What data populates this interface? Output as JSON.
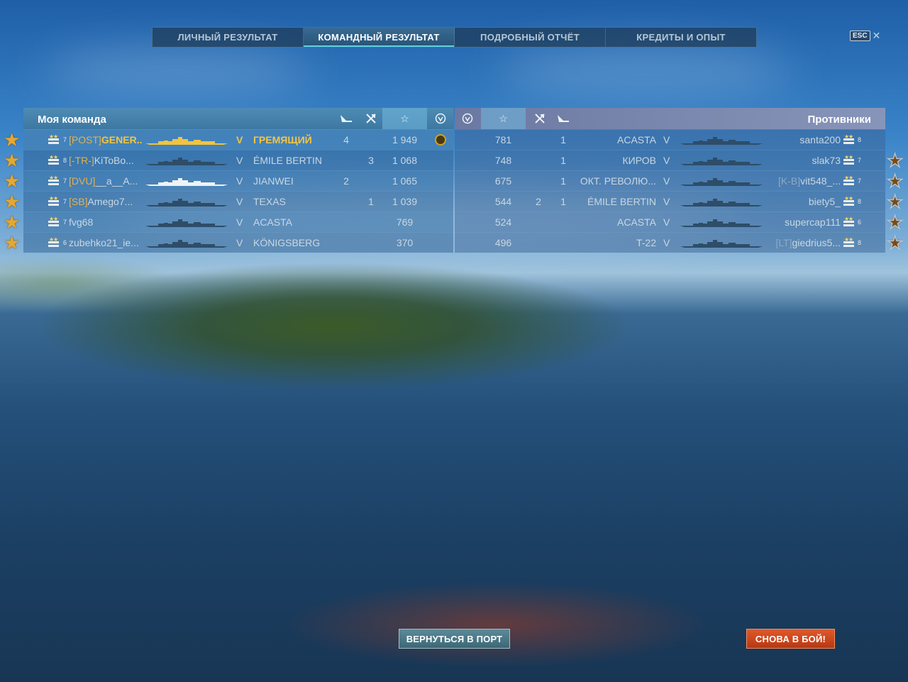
{
  "tabs": [
    {
      "label": "ЛИЧНЫЙ РЕЗУЛЬТАТ",
      "active": false
    },
    {
      "label": "КОМАНДНЫЙ РЕЗУЛЬТАТ",
      "active": true
    },
    {
      "label": "ПОДРОБНЫЙ ОТЧЁТ",
      "active": false
    },
    {
      "label": "КРЕДИТЫ И ОПЫТ",
      "active": false
    }
  ],
  "esc_label": "ESC",
  "my_team": {
    "title": "Моя команда",
    "rows": [
      {
        "tier": "7",
        "clan": "[POST]",
        "name": "GENER...",
        "ship_tier": "V",
        "ship": "ГРЕМЯЩИЙ",
        "planes": "4",
        "kills": "",
        "score": "1 949",
        "emblem": true,
        "me": true
      },
      {
        "tier": "8",
        "clan": "[-TR-]",
        "name": "KiToBo...",
        "ship_tier": "V",
        "ship": "ÉMILE BERTIN",
        "planes": "",
        "kills": "3",
        "score": "1 068",
        "emblem": false,
        "me": false
      },
      {
        "tier": "7",
        "clan": "[DVU]",
        "name": "__a__A...",
        "ship_tier": "V",
        "ship": "JIANWEI",
        "planes": "2",
        "kills": "",
        "score": "1 065",
        "emblem": false,
        "me": false
      },
      {
        "tier": "7",
        "clan": "[SB]",
        "name": "Amego7...",
        "ship_tier": "V",
        "ship": "TEXAS",
        "planes": "",
        "kills": "1",
        "score": "1 039",
        "emblem": false,
        "me": false
      },
      {
        "tier": "7",
        "clan": "",
        "name": "fvg68",
        "ship_tier": "V",
        "ship": "ACASTA",
        "planes": "",
        "kills": "",
        "score": "769",
        "emblem": false,
        "me": false
      },
      {
        "tier": "6",
        "clan": "",
        "name": "zubehko21_ie...",
        "ship_tier": "V",
        "ship": "KÖNIGSBERG",
        "planes": "",
        "kills": "",
        "score": "370",
        "emblem": false,
        "me": false
      }
    ]
  },
  "enemy_team": {
    "title": "Противники",
    "rows": [
      {
        "score": "781",
        "planes": "",
        "kills": "1",
        "ship": "ACASTA",
        "ship_tier": "V",
        "clan": "",
        "name": "santa200",
        "tier": "8",
        "star": "none"
      },
      {
        "score": "748",
        "planes": "",
        "kills": "1",
        "ship": "КИРОВ",
        "ship_tier": "V",
        "clan": "",
        "name": "slak73",
        "tier": "7",
        "star": "hollow"
      },
      {
        "score": "675",
        "planes": "",
        "kills": "1",
        "ship": "ОКТ. РЕВОЛЮ...",
        "ship_tier": "V",
        "clan": "[K-B]",
        "name": "vit548_...",
        "tier": "7",
        "star": "hollow"
      },
      {
        "score": "544",
        "planes": "2",
        "kills": "1",
        "ship": "ÉMILE BERTIN",
        "ship_tier": "V",
        "clan": "",
        "name": "biety5_",
        "tier": "8",
        "star": "hollow"
      },
      {
        "score": "524",
        "planes": "",
        "kills": "",
        "ship": "ACASTA",
        "ship_tier": "V",
        "clan": "",
        "name": "supercap111",
        "tier": "6",
        "star": "hollow"
      },
      {
        "score": "496",
        "planes": "",
        "kills": "",
        "ship": "T-22",
        "ship_tier": "V",
        "clan": "[LT]",
        "name": "giedrius5...",
        "tier": "8",
        "star": "hollow"
      }
    ]
  },
  "buttons": {
    "port": "ВЕРНУТЬСЯ В ПОРТ",
    "battle": "СНОВА В БОЙ!"
  },
  "colors": {
    "accent_gold": "#f5c543",
    "clan_gold": "#e4b04b",
    "battle_button": "#d44a1e",
    "port_button": "#4a7888"
  }
}
